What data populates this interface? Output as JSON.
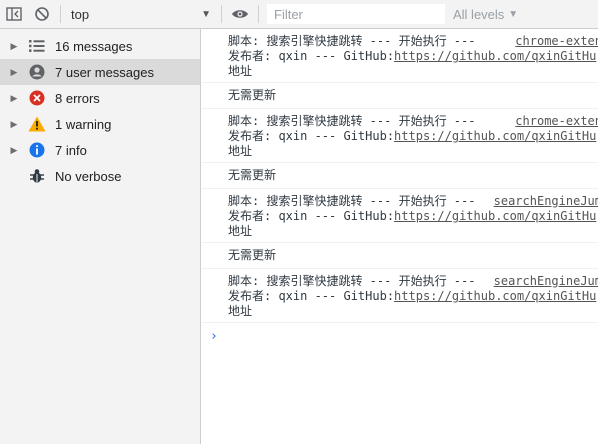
{
  "toolbar": {
    "context": "top",
    "filter_placeholder": "Filter",
    "levels_label": "All levels"
  },
  "sidebar": {
    "items": [
      {
        "label": "16 messages",
        "icon": "list-icon",
        "expandable": true,
        "selected": false
      },
      {
        "label": "7 user messages",
        "icon": "user-icon",
        "expandable": true,
        "selected": true
      },
      {
        "label": "8 errors",
        "icon": "error-icon",
        "expandable": true,
        "selected": false
      },
      {
        "label": "1 warning",
        "icon": "warning-icon",
        "expandable": true,
        "selected": false
      },
      {
        "label": "7 info",
        "icon": "info-icon",
        "expandable": true,
        "selected": false
      },
      {
        "label": "No verbose",
        "icon": "bug-icon",
        "expandable": false,
        "selected": false
      }
    ]
  },
  "console": {
    "messages": [
      {
        "line1": "脚本: 搜索引擎快捷跳转 --- 开始执行 ---",
        "source": "chrome-exten",
        "line2_prefix": "发布者: qxin --- GitHub:",
        "line2_link": "https://github.com/qxinGitHu",
        "line3": "地址"
      },
      {
        "single": "无需更新"
      },
      {
        "line1": "脚本: 搜索引擎快捷跳转 --- 开始执行 ---",
        "source": "chrome-exten",
        "line2_prefix": "发布者: qxin --- GitHub:",
        "line2_link": "https://github.com/qxinGitHu",
        "line3": "地址"
      },
      {
        "single": "无需更新"
      },
      {
        "line1": "脚本: 搜索引擎快捷跳转 --- 开始执行 ---",
        "source": "searchEngineJum",
        "line2_prefix": "发布者: qxin --- GitHub:",
        "line2_link": "https://github.com/qxinGitHu",
        "line3": "地址"
      },
      {
        "single": "无需更新"
      },
      {
        "line1": "脚本: 搜索引擎快捷跳转 --- 开始执行 ---",
        "source": "searchEngineJum",
        "line2_prefix": "发布者: qxin --- GitHub:",
        "line2_link": "https://github.com/qxinGitHu",
        "line3": "地址"
      }
    ],
    "prompt": "›"
  },
  "colors": {
    "error": "#d93025",
    "warning": "#f9ab00",
    "info": "#1a73e8",
    "prompt": "#1a73e8"
  }
}
